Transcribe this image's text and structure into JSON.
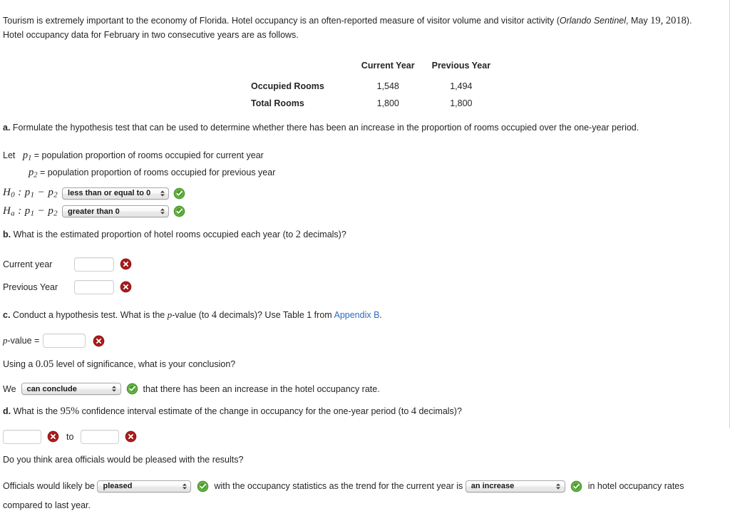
{
  "intro": {
    "text_part1": "Tourism is extremely important to the economy of Florida. Hotel occupancy is an often-reported measure of visitor volume and visitor activity (",
    "source_italic": "Orlando Sentinel",
    "text_part2": ", May ",
    "date_num": "19, 2018",
    "text_part3": "). Hotel occupancy data for February in two consecutive years are as follows."
  },
  "table": {
    "columns": [
      "",
      "Current Year",
      "Previous Year"
    ],
    "rows": [
      {
        "label": "Occupied Rooms",
        "current": "1,548",
        "previous": "1,494"
      },
      {
        "label": "Total Rooms",
        "current": "1,800",
        "previous": "1,800"
      }
    ]
  },
  "part_a": {
    "label": "a.",
    "question": "Formulate the hypothesis test that can be used to determine whether there has been an increase in the proportion of rooms occupied over the one-year period.",
    "let_word": "Let",
    "p1_def": "= population proportion of rooms occupied for current year",
    "p2_def": "= population proportion of rooms occupied for previous year",
    "h0_label": "H",
    "h0_sub": "0",
    "ha_sub": "a",
    "colon": ":",
    "p1": "p",
    "p1_sub": "1",
    "minus": "−",
    "p2": "p",
    "p2_sub": "2",
    "h0_select_value": "less than or equal to 0",
    "h0_status": "correct",
    "ha_select_value": "greater than 0",
    "ha_status": "correct"
  },
  "part_b": {
    "label": "b.",
    "question_pre": "What is the estimated proportion of hotel rooms occupied each year (to ",
    "question_num": "2",
    "question_post": " decimals)?",
    "fields": [
      {
        "label": "Current year",
        "value": "",
        "status": "incorrect"
      },
      {
        "label": "Previous Year",
        "value": "",
        "status": "incorrect"
      }
    ]
  },
  "part_c": {
    "label": "c.",
    "question_pre": "Conduct a hypothesis test. What is the ",
    "p_italic": "p",
    "question_mid": "-value (to ",
    "question_num": "4",
    "question_post": " decimals)? Use Table 1 from ",
    "link_text": "Appendix B",
    "question_end": ".",
    "pvalue_label_p": "p",
    "pvalue_label_rest": "-value =",
    "pvalue_value": "",
    "pvalue_status": "incorrect",
    "sig_pre": "Using a ",
    "sig_num": "0.05",
    "sig_post": " level of significance, what is your conclusion?",
    "we_word": "We",
    "conclusion_select_value": "can conclude",
    "conclusion_status": "correct",
    "conclusion_tail": "that there has been an increase in the hotel occupancy rate."
  },
  "part_d": {
    "label": "d.",
    "question_pre": "What is the ",
    "question_pct": "95%",
    "question_mid": " confidence interval estimate of the change in occupancy for the one-year period (to ",
    "question_num": "4",
    "question_post": " decimals)?",
    "lower_value": "",
    "lower_status": "incorrect",
    "to_word": "to",
    "upper_value": "",
    "upper_status": "incorrect",
    "pleased_question": "Do you think area officials would be pleased with the results?",
    "officials_pre": "Officials would likely be",
    "officials_select_value": "pleased",
    "officials_status": "correct",
    "officials_mid": "with the occupancy statistics as the trend for the current year is",
    "trend_select_value": "an increase",
    "trend_status": "correct",
    "officials_tail": "in hotel occupancy rates compared to last year."
  },
  "colors": {
    "correct_green": "#3f9e2f",
    "incorrect_red": "#b01c1c",
    "link_blue": "#2a6ebb"
  }
}
